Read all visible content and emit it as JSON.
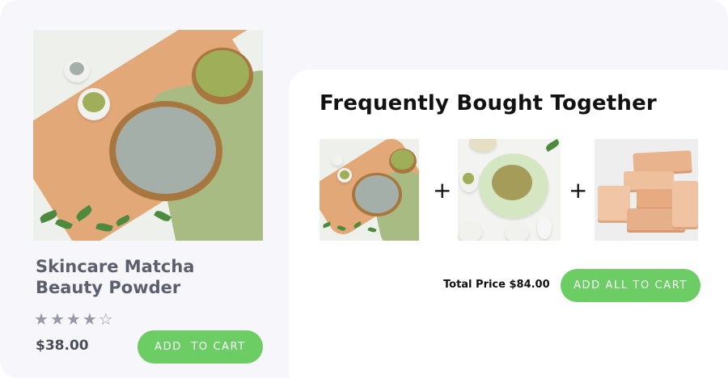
{
  "product": {
    "name": "Skincare Matcha Beauty Powder",
    "rating": 4,
    "rating_max": 5,
    "stars": [
      "★",
      "★",
      "★",
      "★",
      "☆"
    ],
    "price": "$38.00",
    "add_to_cart_label": "ADD  TO CART",
    "image": "matcha-clay-powder-photo"
  },
  "bundle": {
    "title": "Frequently Bought Together",
    "items": [
      {
        "image": "matcha-clay-powder-photo"
      },
      {
        "image": "green-clay-bowl-photo"
      },
      {
        "image": "soap-bars-photo"
      }
    ],
    "separator": "+",
    "total_label": "Total Price $84.00",
    "add_all_label": "ADD ALL TO CART"
  },
  "colors": {
    "accent": "#6bcd63",
    "heading": "#121212",
    "product_text": "#5b5f6e",
    "star": "#9a9aa6"
  }
}
